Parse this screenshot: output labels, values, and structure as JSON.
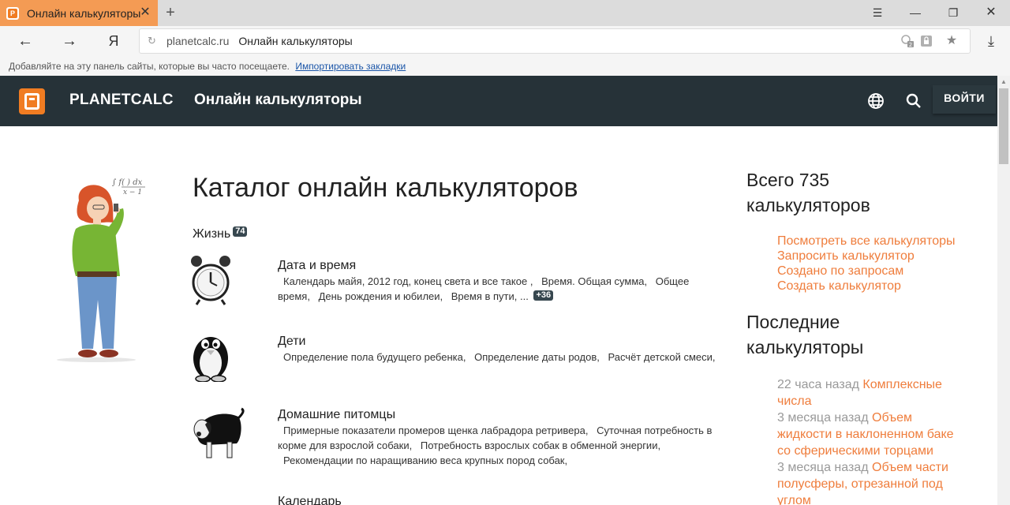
{
  "browser": {
    "tab_title": "Онлайн калькуляторы",
    "new_tab": "+",
    "back": "←",
    "forward": "→",
    "yandex_button": "Я",
    "address_domain": "planetcalc.ru",
    "address_title": "Онлайн калькуляторы",
    "bookmark_hint": "Добавляйте на эту панель сайты, которые вы часто посещаете.",
    "bookmark_import": "Импортировать закладки",
    "protect_count": "2",
    "colors": {
      "tab_active": "#f49b54"
    }
  },
  "header": {
    "brand": "PLANETCALC",
    "title": "Онлайн калькуляторы",
    "login": "ВОЙТИ",
    "colors": {
      "background": "#263238",
      "logo": "#f07c22"
    }
  },
  "main": {
    "title": "Каталог онлайн калькуляторов",
    "section": {
      "name": "Жизнь",
      "count": "74"
    },
    "categories": [
      {
        "name": "Дата и время",
        "icon": "alarm-clock-icon",
        "links": [
          "Календарь майя, 2012 год, конец света и все такое ,",
          "Время. Общая сумма,",
          "Общее время,",
          "День рождения и юбилеи,",
          "Время в пути, ..."
        ],
        "more": "+36"
      },
      {
        "name": "Дети",
        "icon": "penguin-icon",
        "links": [
          "Определение пола будущего ребенка,",
          "Определение даты родов,",
          "Расчёт детской смеси,"
        ]
      },
      {
        "name": "Домашние питомцы",
        "icon": "dog-icon",
        "links": [
          "Примерные показатели промеров щенка лабрадора ретривера,",
          "Суточная потребность в корме для взрослой собаки,",
          "Потребность взрослых собак в обменной энергии,",
          "Рекомендации по наращиванию веса крупных пород собак,"
        ]
      },
      {
        "name": "Календарь",
        "icon": "calendar-icon",
        "links": []
      }
    ]
  },
  "sidebar": {
    "total": "Всего 735 калькуляторов",
    "links": [
      "Посмотреть все калькуляторы",
      "Запросить калькулятор",
      "Создано по запросам",
      "Создать калькулятор"
    ],
    "recent_title": "Последние калькуляторы",
    "recent": [
      {
        "time": "22 часа назад",
        "name": "Комплексные числа"
      },
      {
        "time": "3 месяца назад",
        "name": "Объем жидкости в наклоненном баке со сферическими торцами"
      },
      {
        "time": "3 месяца назад",
        "name": "Объем части полусферы, отрезанной под углом"
      }
    ],
    "colors": {
      "link": "#ef7d3c",
      "muted": "#999999"
    }
  }
}
